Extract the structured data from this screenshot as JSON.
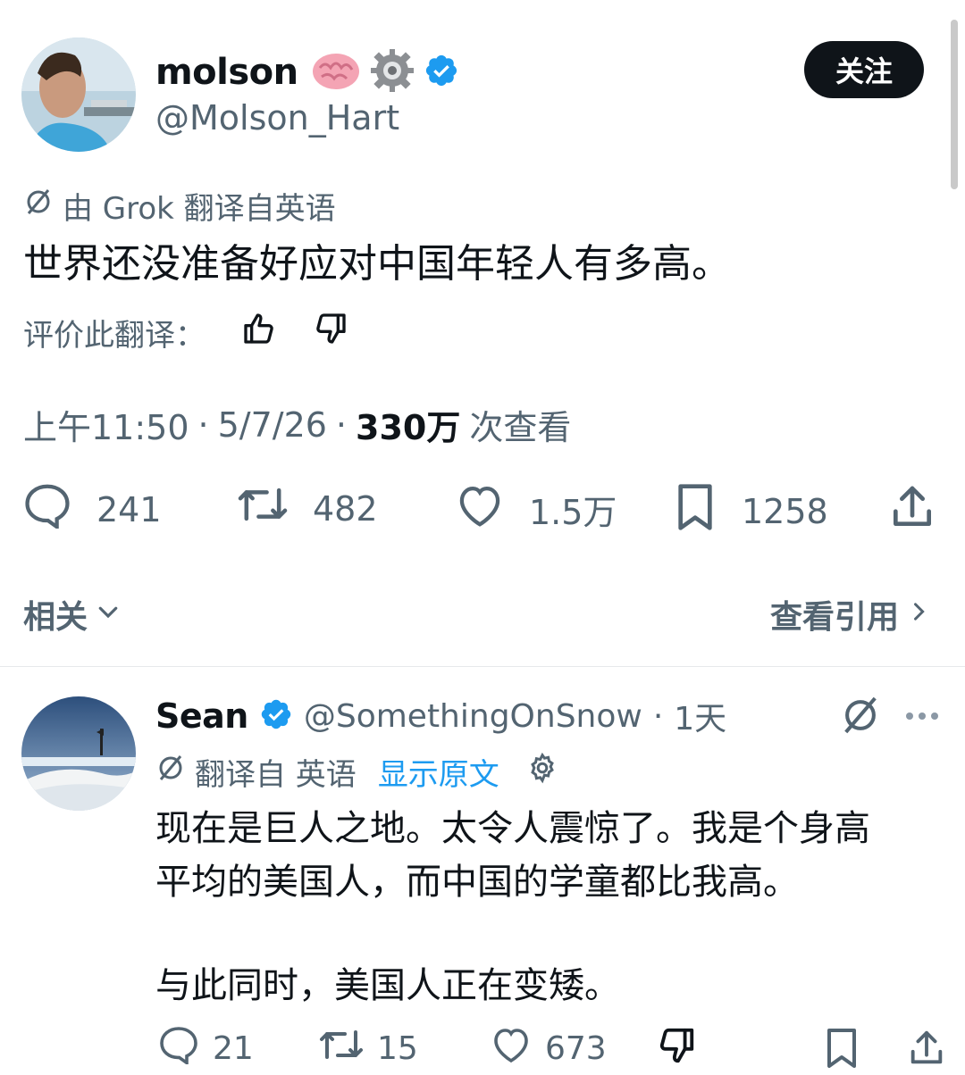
{
  "tweet": {
    "author_name": "molson",
    "author_emoji": "🧠⚙️",
    "handle": "@Molson_Hart",
    "follow_label": "关注",
    "translation_note": "由 Grok 翻译自英语",
    "text": "世界还没准备好应对中国年轻人有多高。",
    "rate_label": "评价此翻译：",
    "time": "上午11:50",
    "sep1": "·",
    "date": "5/7/26",
    "sep2": "·",
    "views": "330万",
    "views_label": "次查看",
    "stats": {
      "replies": "241",
      "retweets": "482",
      "likes": "1.5万",
      "bookmarks": "1258"
    },
    "related_label": "相关",
    "quotes_label": "查看引用"
  },
  "reply": {
    "author_name": "Sean",
    "handle": "@SomethingOnSnow",
    "sep": "·",
    "age": "1天",
    "translation_note": "翻译自 英语",
    "show_original": "显示原文",
    "line1": "现在是巨人之地。太令人震惊了。我是个身高",
    "line2": "平均的美国人，而中国的学童都比我高。",
    "line3": "与此同时，美国人正在变矮。",
    "stats": {
      "replies": "21",
      "retweets": "15",
      "likes": "673"
    }
  },
  "colors": {
    "text": "#0f1419",
    "secondary": "#536471",
    "link": "#1d9bf0",
    "verified": "#1d9bf0",
    "button_bg": "#0f1419"
  },
  "icons": [
    "brain-icon",
    "gear-icon",
    "verified-badge-icon",
    "translate-icon",
    "thumbs-up-icon",
    "thumbs-down-icon",
    "reply-icon",
    "retweet-icon",
    "like-icon",
    "bookmark-icon",
    "share-icon",
    "chevron-down-icon",
    "chevron-right-icon",
    "more-icon",
    "settings-icon"
  ]
}
